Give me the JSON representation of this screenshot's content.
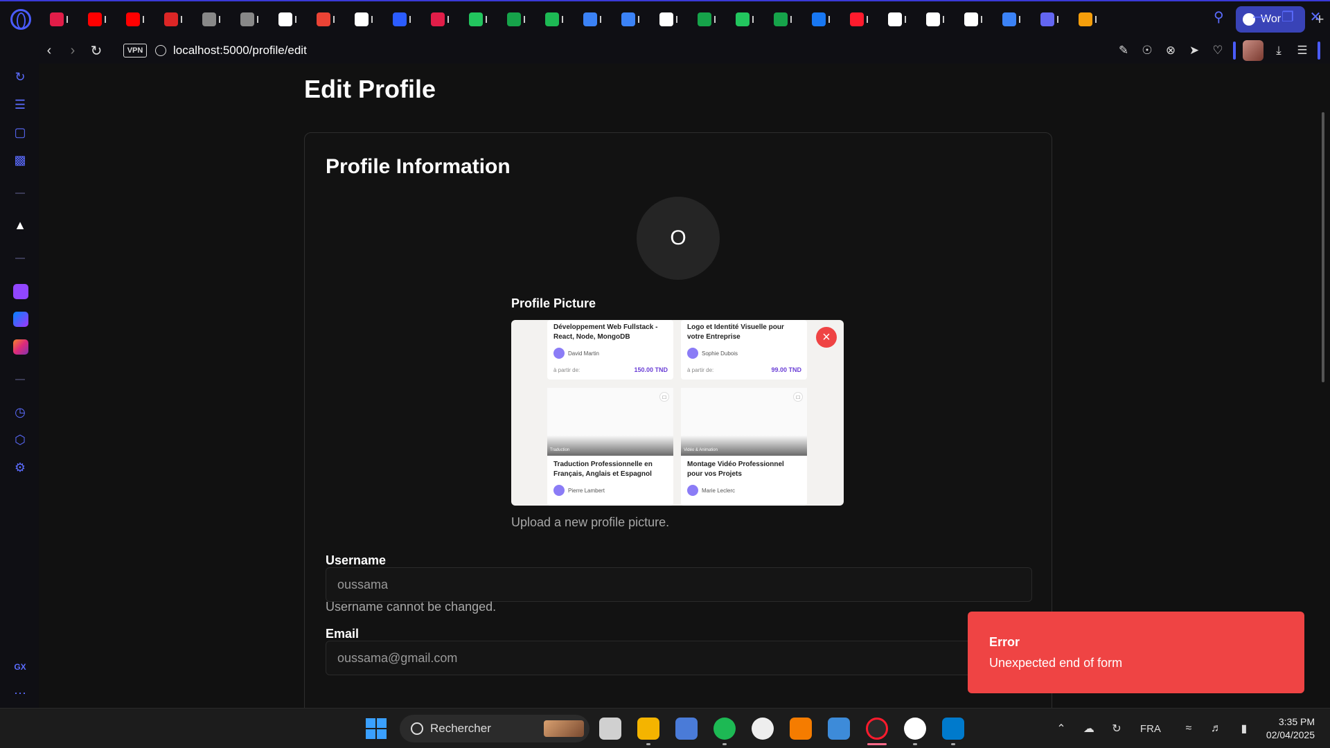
{
  "browser": {
    "active_tab_label": "Wor",
    "url_host": "localhost",
    "url_port_path": ":5000/profile/edit",
    "vpn_label": "VPN"
  },
  "tabs": [
    {
      "icon": "video-icon",
      "color": "#e11d48"
    },
    {
      "icon": "youtube-icon",
      "color": "#ff0000"
    },
    {
      "icon": "youtube-shorts-icon",
      "color": "#ff0000"
    },
    {
      "icon": "speedometer-icon",
      "color": "#dc2626"
    },
    {
      "icon": "tree-icon",
      "color": "#888888"
    },
    {
      "icon": "tree-icon",
      "color": "#888888"
    },
    {
      "icon": "mastodon-icon",
      "color": "#ffffff"
    },
    {
      "icon": "gmail-icon",
      "color": "#ea4335"
    },
    {
      "icon": "github-icon",
      "color": "#ffffff"
    },
    {
      "icon": "word-icon",
      "color": "#2b5cff"
    },
    {
      "icon": "ed-icon",
      "color": "#e11d48"
    },
    {
      "icon": "t-icon",
      "color": "#22c55e"
    },
    {
      "icon": "leaf-icon",
      "color": "#16a34a"
    },
    {
      "icon": "play-icon",
      "color": "#1db954"
    },
    {
      "icon": "vscode-icon",
      "color": "#3b82f6"
    },
    {
      "icon": "vscode-icon",
      "color": "#3b82f6"
    },
    {
      "icon": "stack-icon",
      "color": "#ffffff"
    },
    {
      "icon": "leaf-icon",
      "color": "#16a34a"
    },
    {
      "icon": "link-icon",
      "color": "#22c55e"
    },
    {
      "icon": "leaf-icon",
      "color": "#16a34a"
    },
    {
      "icon": "facebook-icon",
      "color": "#1877f2"
    },
    {
      "icon": "opera-icon",
      "color": "#ff1b2d"
    },
    {
      "icon": "b-icon",
      "color": "#ffffff"
    },
    {
      "icon": "openai-icon",
      "color": "#ffffff"
    },
    {
      "icon": "openai-icon",
      "color": "#ffffff"
    },
    {
      "icon": "dot-icon",
      "color": "#3b82f6"
    },
    {
      "icon": "pen-icon",
      "color": "#6366f1"
    },
    {
      "icon": "figma-icon",
      "color": "#f59e0b"
    }
  ],
  "page": {
    "title": "Edit Profile",
    "card_title": "Profile Information",
    "avatar_initial": "O",
    "profile_picture_label": "Profile Picture",
    "upload_hint": "Upload a new profile picture.",
    "remove_label": "×"
  },
  "preview_cards": [
    {
      "title": "Développement Web Fullstack - React, Node, MongoDB",
      "author": "David Martin",
      "price_label": "à partir de:",
      "price": "150.00 TND"
    },
    {
      "title": "Logo et Identité Visuelle pour votre Entreprise",
      "author": "Sophie Dubois",
      "price_label": "à partir de:",
      "price": "99.00 TND"
    },
    {
      "title": "Traduction Professionnelle en Français, Anglais et Espagnol",
      "author": "Pierre Lambert",
      "category": "Traduction"
    },
    {
      "title": "Montage Vidéo Professionnel pour vos Projets",
      "author": "Marie Leclerc",
      "category": "Vidéo & Animation"
    }
  ],
  "form": {
    "username_label": "Username",
    "username_value": "oussama",
    "username_hint": "Username cannot be changed.",
    "email_label": "Email",
    "email_value": "oussama@gmail.com"
  },
  "toast": {
    "title": "Error",
    "message": "Unexpected end of form"
  },
  "taskbar": {
    "search_placeholder": "Rechercher",
    "language": "FRA",
    "time": "3:35 PM",
    "date": "02/04/2025"
  },
  "sidebar_label": "GX"
}
